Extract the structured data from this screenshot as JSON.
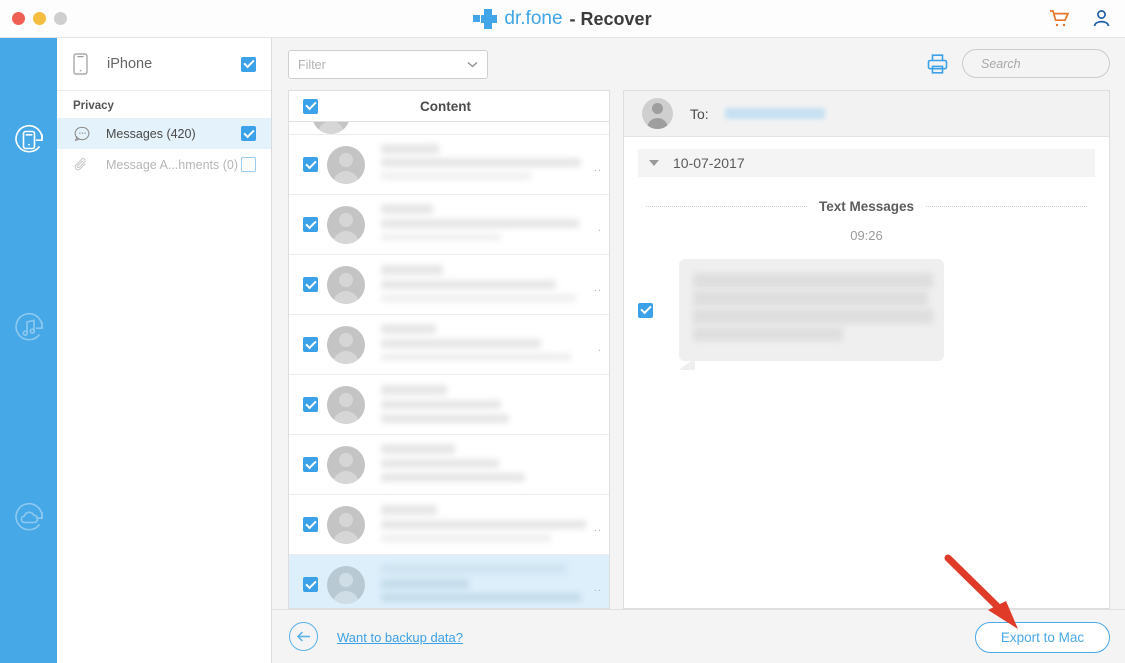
{
  "window": {
    "controls": [
      "close-red",
      "minimize-yellow",
      "zoom-gray-disabled"
    ]
  },
  "brand": {
    "logo_icon": "drfone-cross-logo",
    "name": "dr.fone",
    "separator_and_module": "- Recover",
    "accent_color": "#41a5e8"
  },
  "titlebar_actions": [
    {
      "icon": "shopping-cart-icon",
      "color": "#e8762b"
    },
    {
      "icon": "account-person-icon",
      "color": "#1f5fa8"
    }
  ],
  "rail": {
    "background_color": "#47a8e8",
    "items": [
      {
        "icon": "phone-recovery-icon",
        "active": true
      },
      {
        "icon": "music-recovery-icon",
        "active": false
      },
      {
        "icon": "cloud-recovery-icon",
        "active": false
      }
    ]
  },
  "sidebar": {
    "device": {
      "icon": "iphone-device-icon",
      "label": "iPhone",
      "checked": true
    },
    "group_title": "Privacy",
    "items": [
      {
        "icon": "message-bubble-icon",
        "label": "Messages (420)",
        "checked": true,
        "active": true,
        "disabled": false
      },
      {
        "icon": "paperclip-icon",
        "label": "Message A...hments (0)",
        "checked": false,
        "active": false,
        "disabled": true
      }
    ]
  },
  "toolbar": {
    "filter": {
      "value": "",
      "placeholder": "Filter",
      "chevron_icon": "chevron-down-icon"
    },
    "print_icon": "printer-icon",
    "search": {
      "value": "",
      "placeholder": "Search",
      "icon": "search-icon"
    }
  },
  "list": {
    "select_all_checked": true,
    "header": "Content",
    "rows": [
      {
        "checked": true,
        "partial": true,
        "selected": false,
        "overflow": ""
      },
      {
        "checked": true,
        "partial": false,
        "selected": false,
        "overflow": ".."
      },
      {
        "checked": true,
        "partial": false,
        "selected": false,
        "overflow": "."
      },
      {
        "checked": true,
        "partial": false,
        "selected": false,
        "overflow": ".."
      },
      {
        "checked": true,
        "partial": false,
        "selected": false,
        "overflow": "."
      },
      {
        "checked": true,
        "partial": false,
        "selected": false,
        "overflow": ""
      },
      {
        "checked": true,
        "partial": false,
        "selected": false,
        "overflow": ""
      },
      {
        "checked": true,
        "partial": false,
        "selected": false,
        "overflow": ".."
      },
      {
        "checked": true,
        "partial": false,
        "selected": true,
        "overflow": ".."
      }
    ]
  },
  "detail": {
    "to_label": "To:",
    "to_value_redacted": true,
    "avatar_icon": "contact-avatar-icon",
    "date_group": {
      "collapse_icon": "triangle-down-icon",
      "date": "10-07-2017"
    },
    "section_title": "Text Messages",
    "timestamp": "09:26",
    "message": {
      "checked": true,
      "content_redacted": true
    }
  },
  "footer": {
    "back_icon": "arrow-left-circle-icon",
    "backup_link": "Want to backup data?",
    "export_button": "Export to Mac",
    "export_color": "#4aa9e8"
  },
  "annotation": {
    "arrow_icon": "red-pointer-arrow",
    "color": "#e03a28"
  }
}
